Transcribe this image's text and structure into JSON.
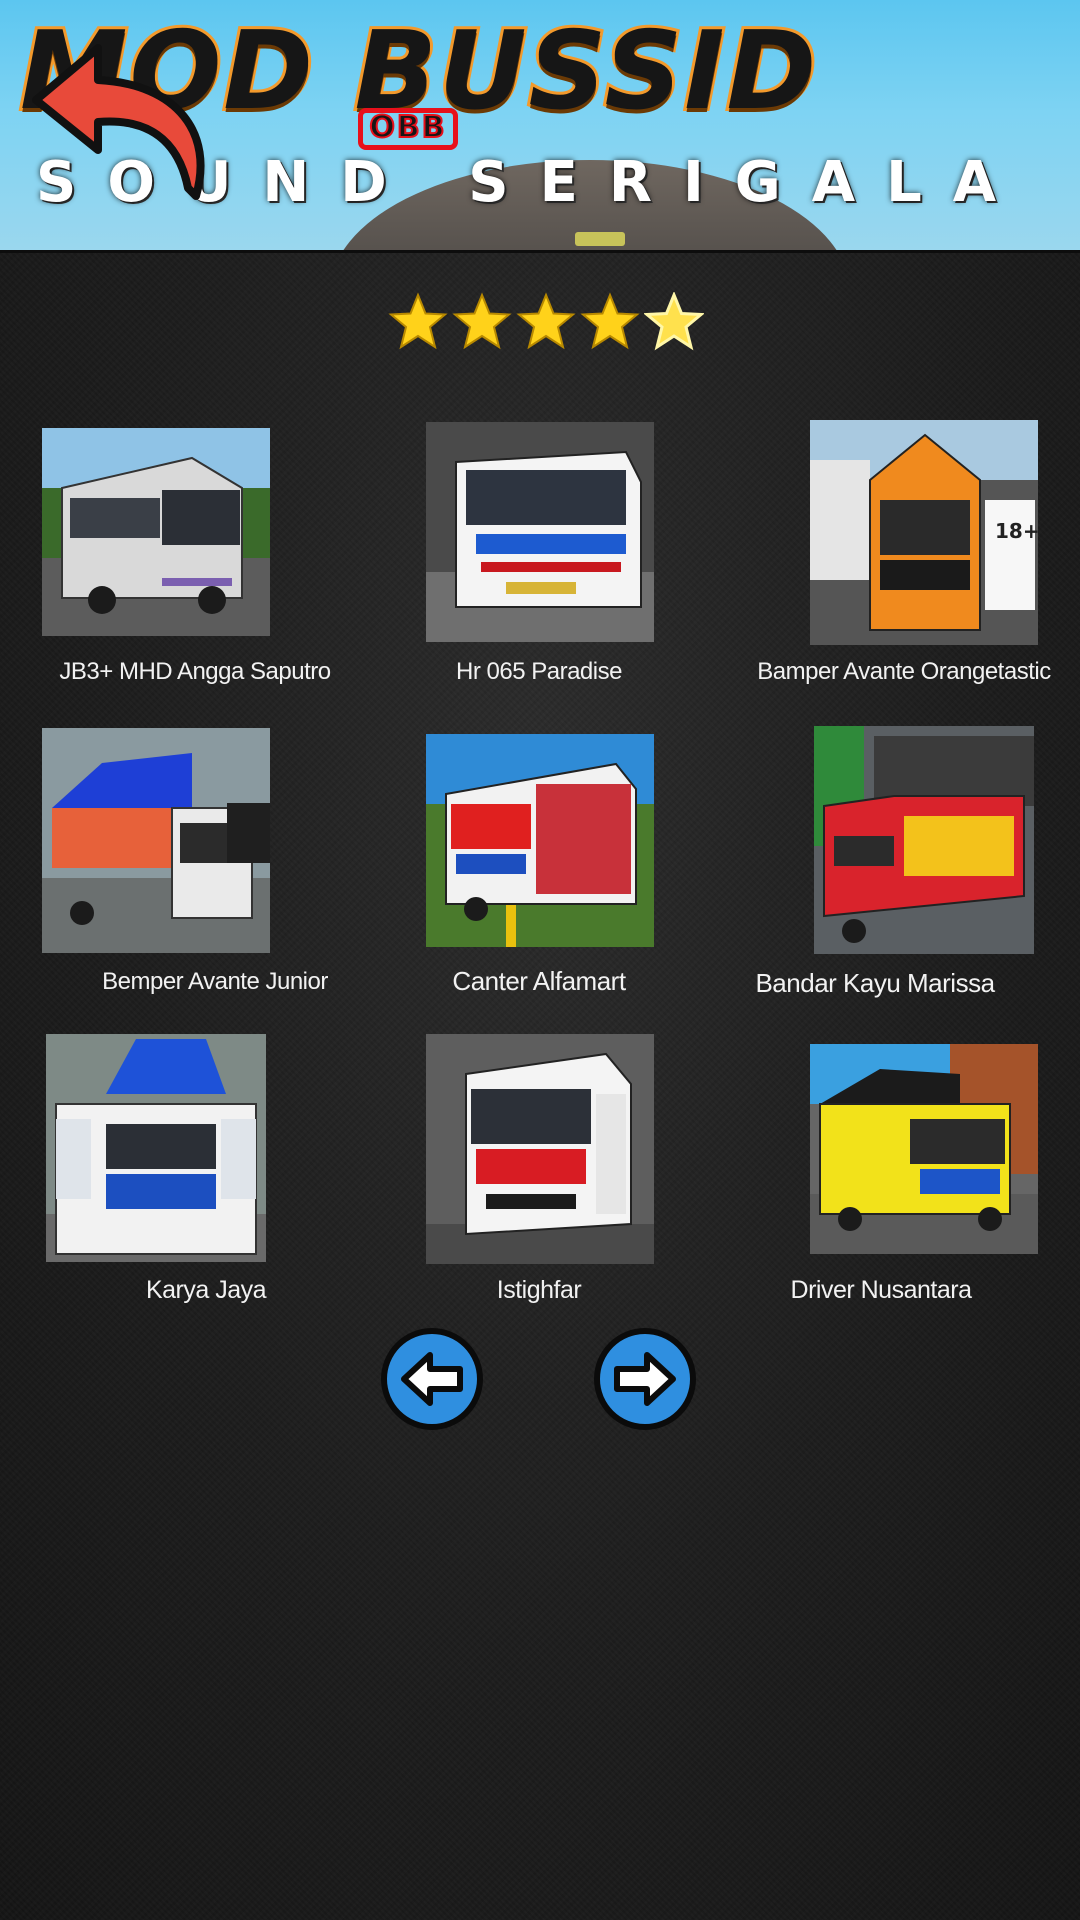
{
  "header": {
    "title_main": "MOD BUSSID",
    "badge": "OBB",
    "title_sub": "SOUND SERIGALA"
  },
  "rating": {
    "stars": 5
  },
  "items": [
    {
      "label": "JB3+ MHD Angga Saputro"
    },
    {
      "label": "Hr 065 Paradise"
    },
    {
      "label": "Bamper Avante Orangetastic"
    },
    {
      "label": "Bemper Avante Junior"
    },
    {
      "label": "Canter Alfamart"
    },
    {
      "label": "Bandar Kayu Marissa"
    },
    {
      "label": "Karya Jaya"
    },
    {
      "label": "Istighfar"
    },
    {
      "label": "Driver Nusantara"
    }
  ],
  "icons": {
    "back": "back-arrow-icon",
    "prev": "arrow-left-icon",
    "next": "arrow-right-icon",
    "star": "star-icon"
  },
  "colors": {
    "accent_orange": "#f39a2c",
    "badge_red": "#e8101b",
    "nav_blue": "#2f8fe0",
    "star_gold": "#ffd21a",
    "back_red": "#e84a3a"
  }
}
